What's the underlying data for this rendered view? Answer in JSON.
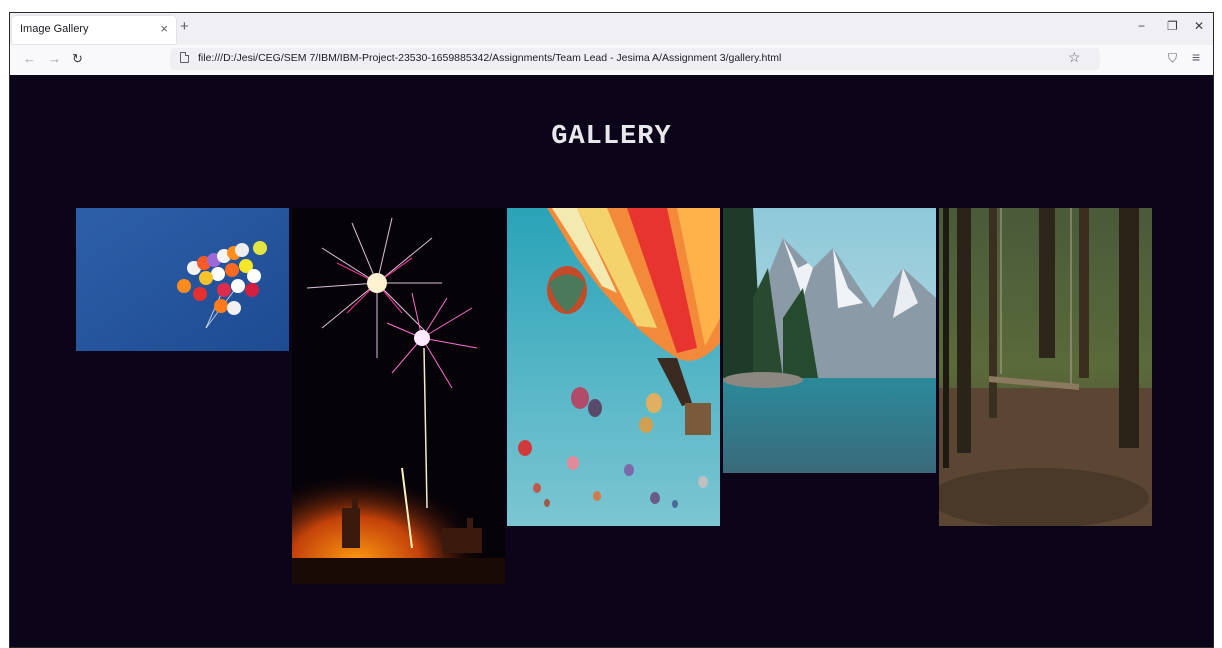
{
  "browser": {
    "tab_title": "Image Gallery",
    "tab_close": "×",
    "new_tab": "+",
    "url": "file:///D:/Jesi/CEG/SEM 7/IBM/IBM-Project-23530-1659885342/Assignments/Team Lead - Jesima A/Assignment 3/gallery.html",
    "back": "←",
    "forward": "→",
    "reload": "↻",
    "bookmark": "☆",
    "pocket": "⛉",
    "menu": "≡",
    "minimize": "−",
    "restore": "❐",
    "close": "✕"
  },
  "page": {
    "title": "GALLERY",
    "background": "#0c0418",
    "images": [
      {
        "subject": "balloons"
      },
      {
        "subject": "fireworks"
      },
      {
        "subject": "hot-air-balloons"
      },
      {
        "subject": "mountain-lake"
      },
      {
        "subject": "forest-swing"
      }
    ]
  }
}
